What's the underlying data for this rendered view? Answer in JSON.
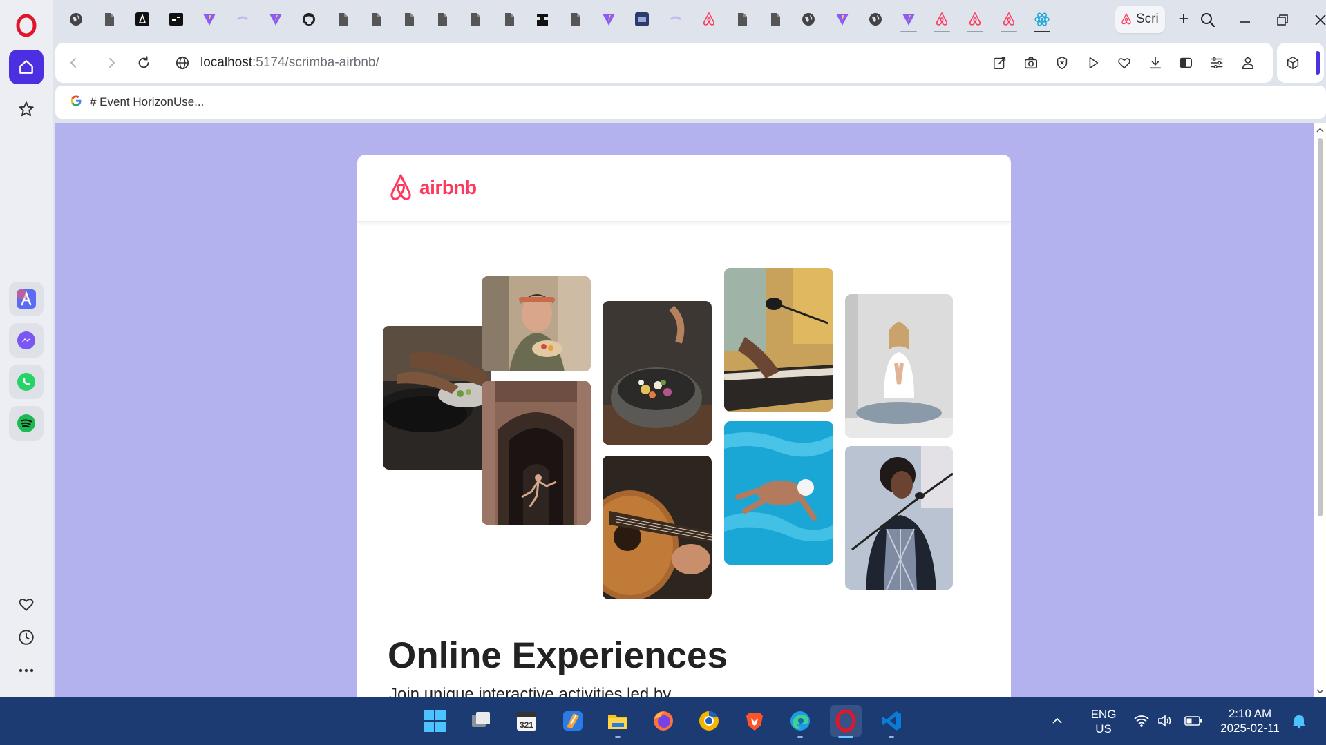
{
  "browser": {
    "active_tab_title": "Scri",
    "url_host": "localhost",
    "url_path": ":5174/scrimba-airbnb/",
    "bookmark_label": "# Event HorizonUse...",
    "new_tab_label": "+"
  },
  "page": {
    "brand": "airbnb",
    "title": "Online Experiences",
    "subtitle": "Join unique interactive activities led by"
  },
  "taskbar": {
    "lang_primary": "ENG",
    "lang_secondary": "US",
    "time": "2:10 AM",
    "date": "2025-02-11"
  },
  "colors": {
    "page_background": "#b3b2ee",
    "brand": "#ff385c",
    "opera_red": "#e0162b",
    "taskbar": "#1c3b73"
  },
  "icons": {
    "tabs": [
      "globe-icon",
      "doc-icon",
      "astro-icon",
      "terminal-icon",
      "vite-icon",
      "blank-icon",
      "vite-icon",
      "github-icon",
      "doc-icon",
      "doc-icon",
      "doc-icon",
      "doc-icon",
      "doc-icon",
      "doc-icon",
      "wizard-icon",
      "doc-icon",
      "vite-icon",
      "app-icon",
      "blank-icon",
      "airbnb-icon",
      "doc-icon",
      "doc-icon",
      "globe-icon",
      "vite-icon",
      "globe-icon",
      "vite-icon",
      "airbnb-icon",
      "airbnb-icon",
      "airbnb-icon",
      "react-icon"
    ]
  }
}
